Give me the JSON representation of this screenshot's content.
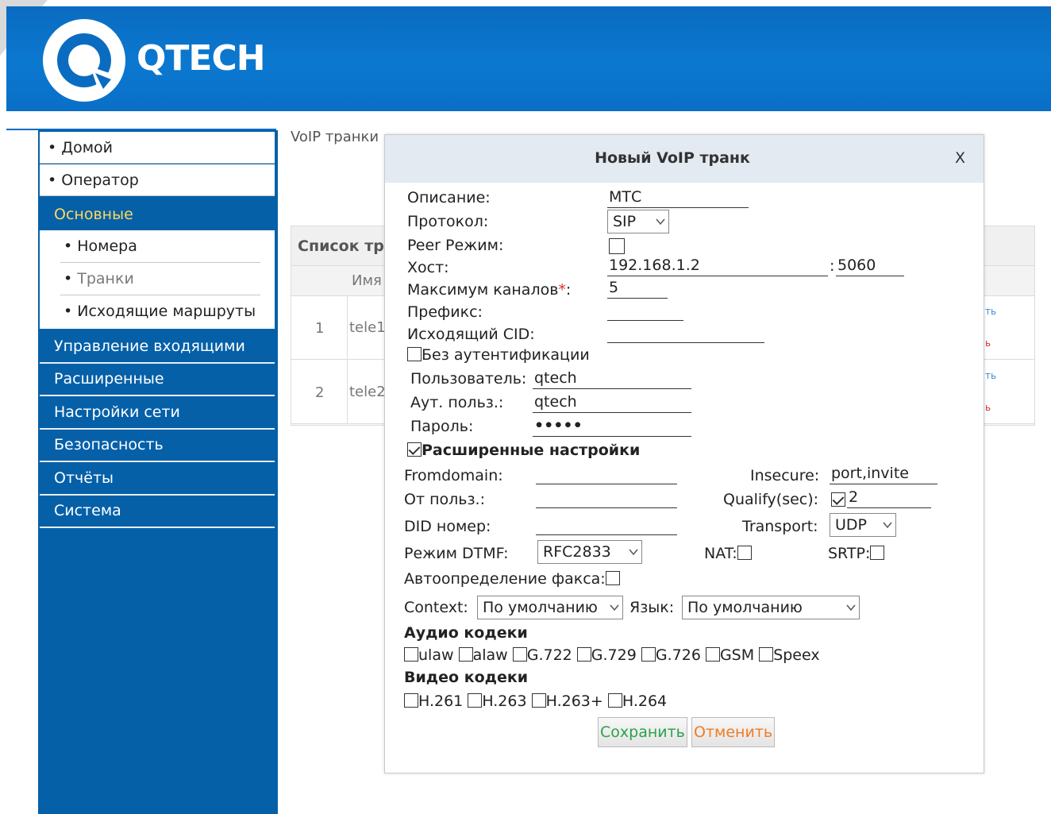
{
  "header": {
    "brand": "QTECH"
  },
  "sidebar": {
    "home": "Домой",
    "operator": "Оператор",
    "basic": "Основные",
    "sub": [
      "Номера",
      "Транки",
      "Исходящие маршруты"
    ],
    "main": [
      "Управление входящими",
      "Расширенные",
      "Настройки сети",
      "Безопасность",
      "Отчёты",
      "Система"
    ]
  },
  "background": {
    "title": "VoIP транки",
    "list_header": "Список тр",
    "col_name": "Имя",
    "rows": [
      {
        "num": "1",
        "name": "tele1"
      },
      {
        "num": "2",
        "name": "tele2"
      }
    ],
    "act_edit": "ть",
    "act_del": "ь"
  },
  "modal": {
    "title": "Новый VoIP транк",
    "close": "X",
    "description_label": "Описание:",
    "description_value": "МТС",
    "protocol_label": "Протокол:",
    "protocol_value": "SIP",
    "peer_label": "Peer Режим:",
    "host_label": "Хост:",
    "host_value": "192.168.1.2",
    "port_value": "5060",
    "port_sep": ":",
    "maxch_label": "Максимум каналов",
    "maxch_req": "*",
    "maxch_colon": ":",
    "maxch_value": "5",
    "prefix_label": "Префикс:",
    "outcid_label": "Исходящий CID:",
    "noauth_label": "Без аутентификации",
    "user_label": "Пользователь:",
    "user_value": "qtech",
    "authuser_label": "Аут. польз.:",
    "authuser_value": "qtech",
    "password_label": "Пароль:",
    "password_value": "•••••",
    "advanced_label": "Расширенные настройки",
    "fromdomain_label": "Fromdomain:",
    "insecure_label": "Insecure:",
    "insecure_value": "port,invite",
    "fromuser_label": "От польз.:",
    "qualify_label": "Qualify(sec):",
    "qualify_value": "2",
    "did_label": "DID номер:",
    "transport_label": "Transport:",
    "transport_value": "UDP",
    "dtmf_label": "Режим DTMF:",
    "dtmf_value": "RFC2833",
    "nat_label": "NAT:",
    "srtp_label": "SRTP:",
    "fax_label": "Автоопределение факса:",
    "context_label": "Context:",
    "context_value": "По умолчанию",
    "lang_label": "Язык:",
    "lang_value": "По умолчанию",
    "audio_title": "Аудио кодеки",
    "audio_codecs": [
      "ulaw",
      "alaw",
      "G.722",
      "G.729",
      "G.726",
      "GSM",
      "Speex"
    ],
    "video_title": "Видео кодеки",
    "video_codecs": [
      "H.261",
      "H.263",
      "H.263+",
      "H.264"
    ],
    "save": "Сохранить",
    "cancel": "Отменить"
  },
  "colors": {
    "header_blue": "#0a6cc1",
    "sidebar_blue": "#0560a8",
    "active_text": "#ffd75c",
    "save_green": "#2aa24a",
    "cancel_orange": "#f07c23"
  }
}
